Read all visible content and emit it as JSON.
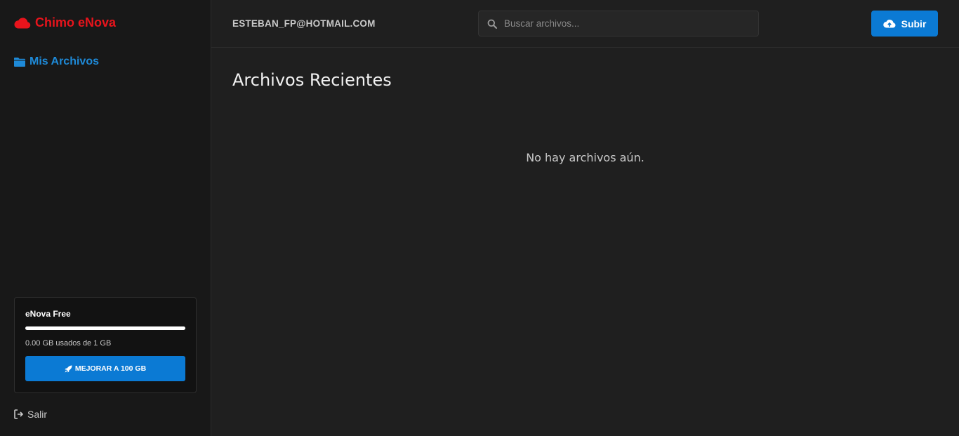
{
  "brand": {
    "name": "Chimo eNova",
    "icon": "cloud-icon",
    "color": "#e8141c"
  },
  "sidebar": {
    "nav": [
      {
        "label": "Mis Archivos",
        "icon": "folder-icon"
      }
    ],
    "plan": {
      "name": "eNova Free",
      "usage_text": "0.00 GB usados de 1 GB",
      "usage_fraction": 0.0,
      "upgrade_label": "MEJORAR A 100 GB",
      "upgrade_icon": "rocket-icon"
    },
    "logout_label": "Salir",
    "logout_icon": "sign-out-icon"
  },
  "header": {
    "user_email": "ESTEBAN_FP@HOTMAIL.COM",
    "search": {
      "placeholder": "Buscar archivos...",
      "value": "",
      "icon": "search-icon"
    },
    "upload_label": "Subir",
    "upload_icon": "cloud-upload-icon"
  },
  "main": {
    "title": "Archivos Recientes",
    "empty_message": "No hay archivos aún."
  },
  "colors": {
    "accent": "#0b7ad4",
    "link": "#1e8ad8",
    "background": "#1f1f1f",
    "sidebar": "#181818"
  }
}
